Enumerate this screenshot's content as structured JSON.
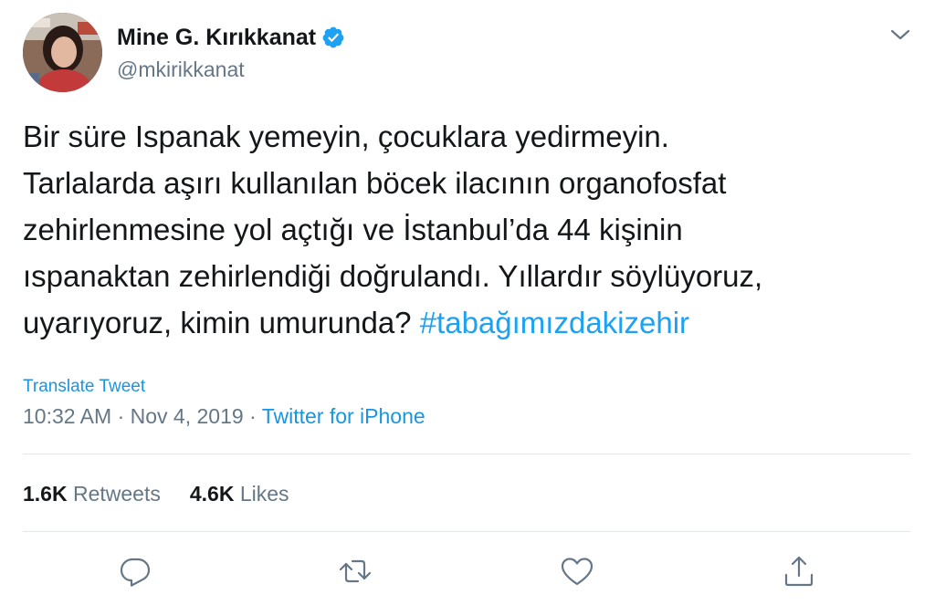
{
  "author": {
    "display_name": "Mine G. Kırıkkanat",
    "handle": "@mkirikkanat",
    "verified": true,
    "avatar_icon": "profile-photo"
  },
  "tweet": {
    "text_plain": "Bir süre Ispanak yemeyin, çocuklara yedirmeyin.\nTarlalarda aşırı kullanılan böcek ilacının organofosfat\nzehirlenmesine yol açtığı ve İstanbul’da 44 kişinin\nıspanaktan zehirlendiği doğrulandı. Yıllardır söylüyoruz,\nuyarıyoruz, kimin umurunda? ",
    "hashtag": "#tabağımızdakizehir"
  },
  "translate_label": "Translate Tweet",
  "meta": {
    "time": "10:32 AM",
    "separator1": " · ",
    "date": "Nov 4, 2019",
    "separator2": " · ",
    "source": "Twitter for iPhone"
  },
  "stats": {
    "retweets_count": "1.6K",
    "retweets_label": "Retweets",
    "likes_count": "4.6K",
    "likes_label": "Likes"
  },
  "actions": {
    "reply_icon": "reply-icon",
    "retweet_icon": "retweet-icon",
    "like_icon": "heart-icon",
    "share_icon": "share-icon"
  },
  "colors": {
    "link": "#1b95e0",
    "hashtag": "#1da1f2",
    "muted": "#657786",
    "text": "#14171a",
    "divider": "#e1e8ed",
    "verified": "#1da1f2"
  }
}
